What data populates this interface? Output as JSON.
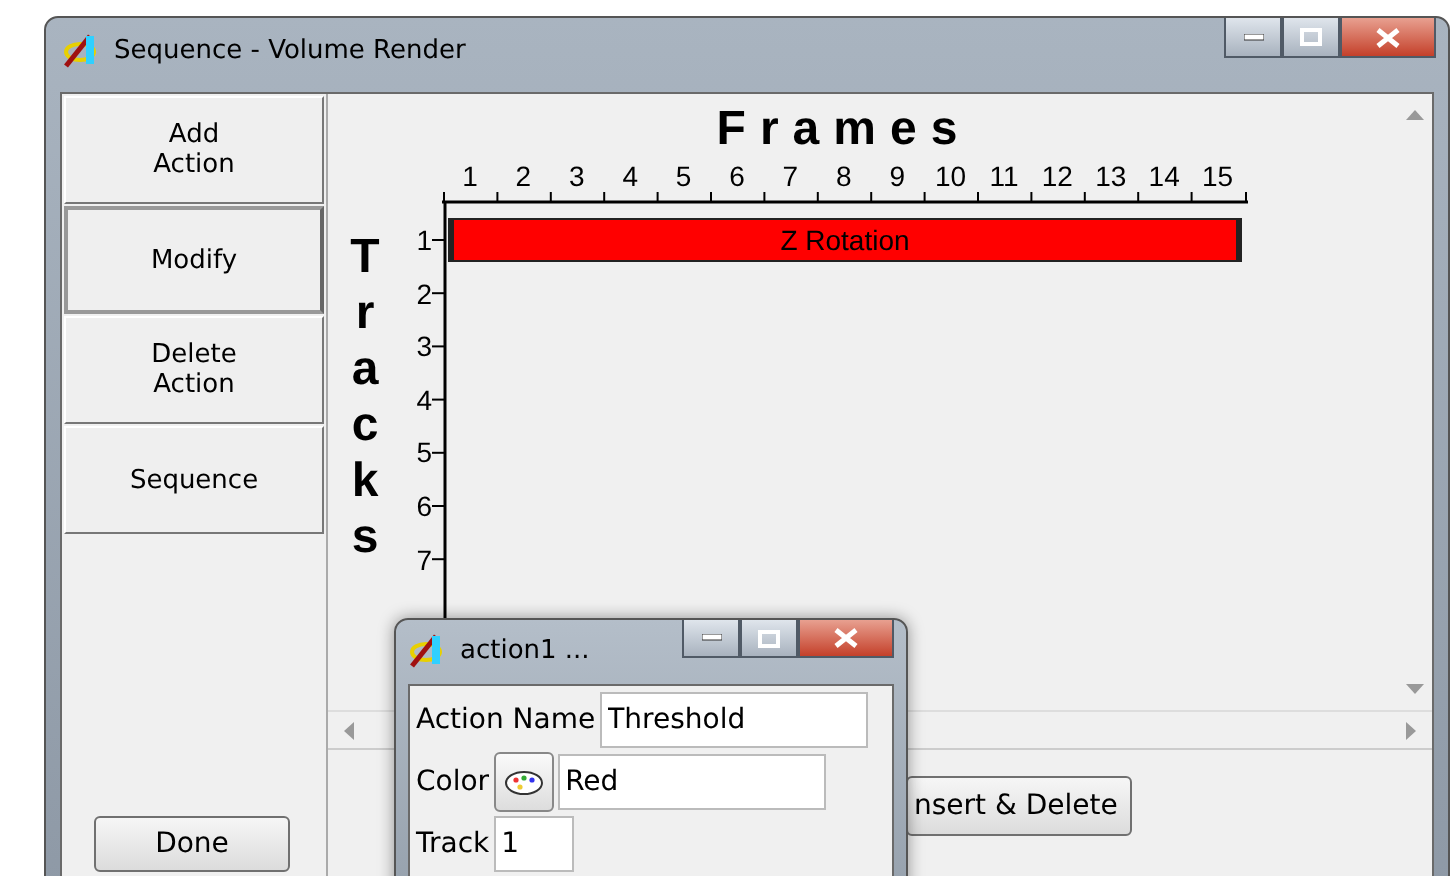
{
  "window": {
    "title": "Sequence - Volume Render"
  },
  "sidebar": {
    "buttons": [
      {
        "label": "Add Action"
      },
      {
        "label": "Modify"
      },
      {
        "label": "Delete Action"
      },
      {
        "label": "Sequence"
      }
    ],
    "done_button": "Done"
  },
  "timeline": {
    "title": "Frames",
    "frames": [
      "1",
      "2",
      "3",
      "4",
      "5",
      "6",
      "7",
      "8",
      "9",
      "10",
      "11",
      "12",
      "13",
      "14",
      "15"
    ],
    "axis_title": "Tracks",
    "tracks": [
      "1",
      "2",
      "3",
      "4",
      "5",
      "6",
      "7"
    ],
    "actions": [
      {
        "label": "Z Rotation",
        "color": "#ff0000"
      }
    ]
  },
  "insert_button": "nsert &  Delete",
  "dialog": {
    "title": "action1 ...",
    "fields": [
      {
        "kind": "text",
        "label": "Action Name",
        "value": "Threshold"
      },
      {
        "kind": "color",
        "label": "Color",
        "value": "Red"
      },
      {
        "kind": "text",
        "label": "Track",
        "value": "1"
      }
    ]
  }
}
